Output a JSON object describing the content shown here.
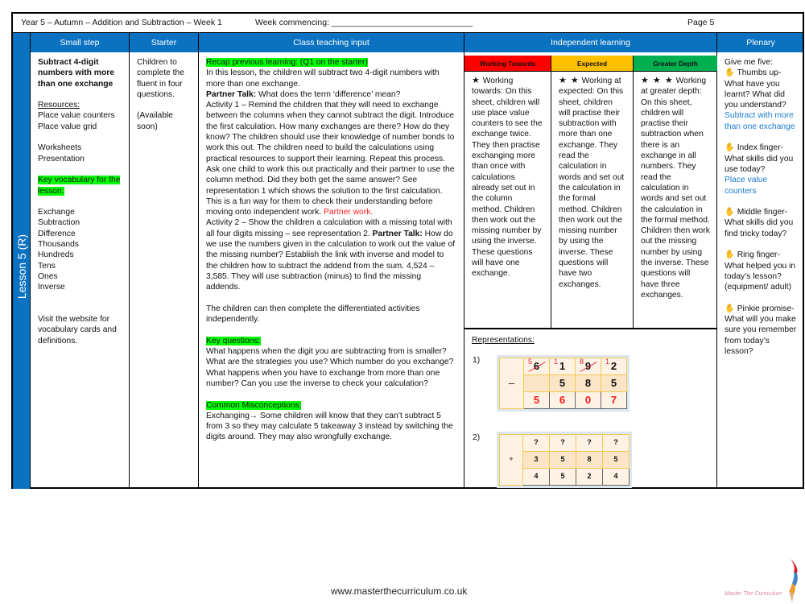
{
  "header": {
    "title": "Year 5 – Autumn – Addition and Subtraction – Week 1",
    "week_commencing": "Week commencing: ______________________________",
    "page": "Page 5"
  },
  "columns": {
    "small_step": "Small step",
    "starter": "Starter",
    "teaching": "Class teaching input",
    "independent": "Independent learning",
    "plenary": "Plenary"
  },
  "lesson_label": "Lesson 5 (R)",
  "small_step": {
    "title": "Subtract 4-digit numbers with more than one exchange",
    "resources_heading": "Resources:",
    "resources": [
      "Place value counters",
      "Place value grid"
    ],
    "materials": [
      "Worksheets",
      "Presentation"
    ],
    "vocab_heading": "Key vocabulary for the lesson:",
    "vocab": [
      "Exchange",
      "Subtraction",
      "Difference",
      "Thousands",
      "Hundreds",
      "Tens",
      "Ones",
      "Inverse"
    ],
    "website_note": "Visit the website for vocabulary cards and definitions."
  },
  "starter": {
    "text": "Children to complete the fluent in four questions.",
    "note": "(Available soon)"
  },
  "teaching": {
    "recap": "Recap previous learning: (Q1 on the starter)",
    "intro": "In this lesson, the children will subtract two 4-digit numbers with more than one exchange.",
    "partner_talk_label": "Partner Talk:",
    "partner_talk_1": " What does the term ‘difference’ mean?",
    "activity1": "Activity 1 – Remind the children that they will need to exchange between the columns when they cannot subtract the digit. Introduce the first calculation. How many exchanges are there? How do they know? The children should use their knowledge of number bonds to work this out. The children need to build the calculations using practical resources to support their learning. Repeat this process. Ask one child to work this out practically and their partner to use the column method. Did they both get the same answer? See representation 1 which shows the solution to the first calculation. This is a fun way for them to check their understanding before moving onto independent work. ",
    "partner_work": "Partner work.",
    "activity2_a": "Activity 2 – Show the children a calculation with a missing total with all four digits missing – see representation 2. ",
    "activity2_b": " How do we use the numbers given in the calculation to work out the value of the missing number? Establish the link with inverse and model to the children how to subtract the addend from the sum. 4,524 – 3,585. They will use subtraction (minus) to find the missing addends.",
    "independent_note": "The children can then complete the differentiated activities independently.",
    "key_questions_heading": "Key questions:",
    "key_questions": "What happens when the digit you are subtracting from is smaller?  What are the strategies you use? Which number do you exchange? What happens when you have to exchange from more than one number? Can you use the inverse to check your calculation?",
    "misconceptions_heading": "Common Misconceptions:",
    "misconceptions": "Exchanging→ Some children will know that they can’t subtract 5 from 3 so they may calculate 5 takeaway 3 instead by switching the digits around. They may also wrongfully exchange."
  },
  "independent": {
    "levels": [
      {
        "name": "Working Towards",
        "color": "#ff0000",
        "stars": "★",
        "text": " Working towards: On this sheet, children will use place value counters to see the exchange twice. They then practise exchanging more than once with calculations already set out in the column method. Children then work out the missing number by using the inverse. These questions will have one exchange."
      },
      {
        "name": "Expected",
        "color": "#ffc000",
        "stars": "★ ★",
        "text": " Working at expected: On this sheet, children will practise their subtraction with more than one exchange. They read the calculation in words and set out the calculation in the formal method. Children then work out the missing number by using the inverse. These questions will have two exchanges."
      },
      {
        "name": "Greater Depth",
        "color": "#00b050",
        "stars": "★ ★ ★",
        "text": " Working at greater depth: On this sheet, children will practise their subtraction when there is an exchange in all numbers. They read the calculation in words and set out the calculation in the formal method. Children then work out the missing number by using the inverse. These questions will have three exchanges."
      }
    ],
    "representations_heading": "Representations:",
    "rep1": {
      "label": "1)",
      "operator": "–",
      "top": [
        "6",
        "1",
        "9",
        "2"
      ],
      "exchanges": [
        "5",
        "1",
        "8",
        "1"
      ],
      "middle": [
        "",
        "5",
        "8",
        "5"
      ],
      "answer": [
        "5",
        "6",
        "0",
        "7"
      ]
    },
    "rep2": {
      "label": "2)",
      "operator": "+",
      "top": [
        "?",
        "?",
        "?",
        "?"
      ],
      "middle": [
        "3",
        "5",
        "8",
        "5"
      ],
      "answer": [
        "4",
        "5",
        "2",
        "4"
      ]
    }
  },
  "plenary": {
    "intro": "Give me five:",
    "items": [
      {
        "icon": "hand",
        "text": " Thumbs up- What have you learnt? What did you understand?",
        "answer": "Subtract with more than one exchange"
      },
      {
        "icon": "hand",
        "text": " Index finger- What skills did you use today?",
        "answer": "Place value counters"
      },
      {
        "icon": "hand",
        "text": " Middle finger- What skills did you find tricky today?",
        "answer": ""
      },
      {
        "icon": "hand",
        "text": " Ring finger- What helped you in today’s lesson? (equipment/ adult)",
        "answer": ""
      },
      {
        "icon": "hand",
        "text": " Pinkie promise- What will you make sure you remember from today’s lesson?",
        "answer": ""
      }
    ]
  },
  "footer": {
    "url": "www.masterthecurriculum.co.uk",
    "logo_text": "Master The Curriculum"
  }
}
